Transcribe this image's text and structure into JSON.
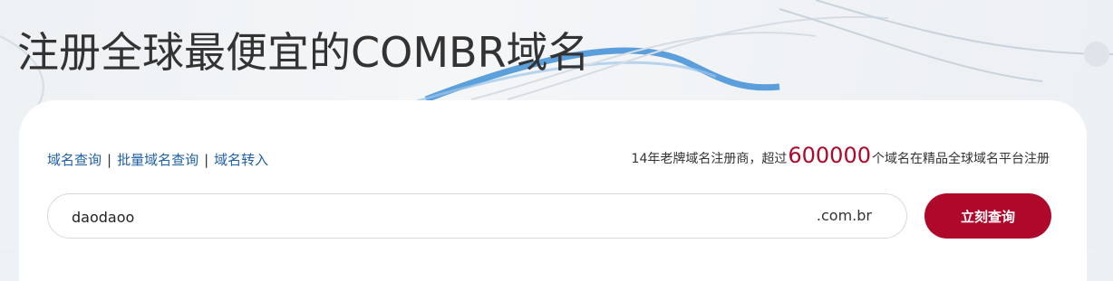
{
  "hero": {
    "title": "注册全球最便宜的COMBR域名"
  },
  "nav_links": [
    {
      "label": "域名查询"
    },
    {
      "label": "批量域名查询"
    },
    {
      "label": "域名转入"
    }
  ],
  "separator": "|",
  "stats": {
    "prefix": "14年老牌域名注册商，超过",
    "count": "600000",
    "suffix": "个域名在精品全球域名平台注册"
  },
  "search": {
    "value": "daodaoo",
    "domain_suffix": ".com.br",
    "button_label": "立刻查询"
  },
  "colors": {
    "accent": "#b0082a",
    "link": "#1f5fa6",
    "wave": "#3f8fd6"
  }
}
